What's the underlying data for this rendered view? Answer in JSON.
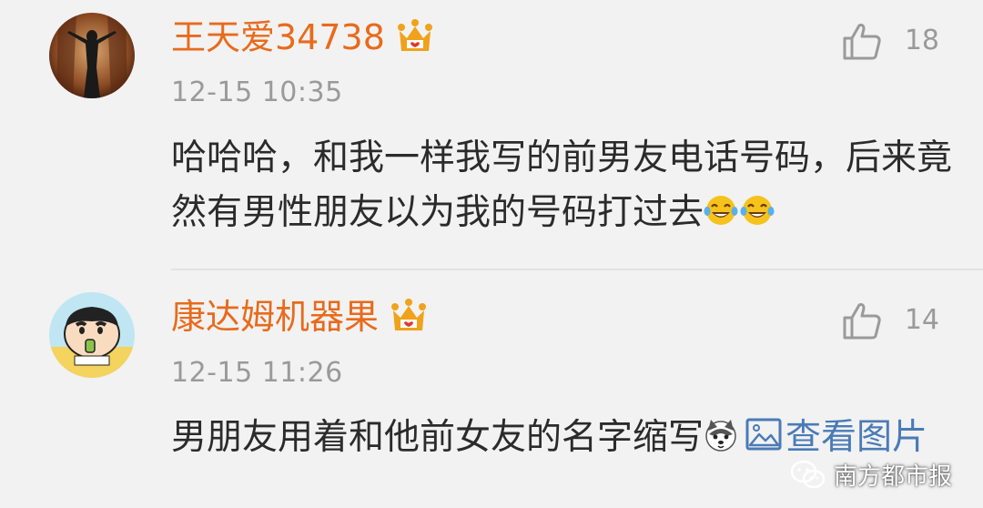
{
  "comments": [
    {
      "username": "王天爱34738",
      "timestamp": "12-15 10:35",
      "likes": "18",
      "text": "哈哈哈，和我一样我写的前男友电话号码，后来竟然有男性朋友以为我的号码打过去",
      "avatar": "woman-silhouette-avatar",
      "emojis": [
        "laughing-crying-emoji",
        "laughing-crying-emoji"
      ]
    },
    {
      "username": "康达姆机器果",
      "timestamp": "12-15 11:26",
      "likes": "14",
      "text": "男朋友用着和他前女友的名字缩写",
      "avatar": "cartoon-boy-avatar",
      "emojis": [
        "husky-dog-emoji"
      ],
      "view_image": "查看图片"
    }
  ],
  "watermark": "南方都市报",
  "colors": {
    "background": "#f2f2f2",
    "username": "#e86b1c",
    "meta": "#9a9a9a",
    "body": "#2b2b2b",
    "link": "#4a7bb7",
    "crown": "#f0a21a"
  }
}
